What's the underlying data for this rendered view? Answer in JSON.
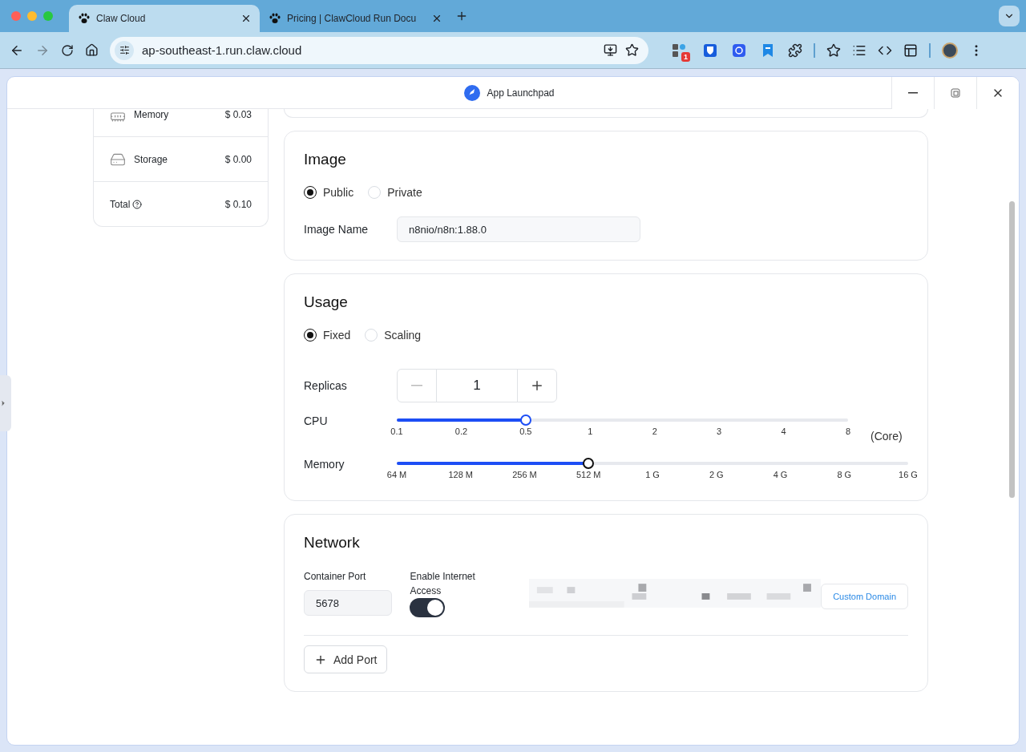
{
  "browser": {
    "tabs": [
      {
        "title": "Claw Cloud",
        "selected": true
      },
      {
        "title": "Pricing | ClawCloud Run Docu",
        "selected": false
      }
    ],
    "url": "ap-southeast-1.run.claw.cloud",
    "extension_badge": "1"
  },
  "window": {
    "title": "App Launchpad"
  },
  "cost": [
    {
      "kind": "memory",
      "label": "Memory",
      "value": "$ 0.03"
    },
    {
      "kind": "storage",
      "label": "Storage",
      "value": "$ 0.00"
    },
    {
      "kind": "total",
      "label": "Total",
      "value": "$ 0.10"
    }
  ],
  "image": {
    "title": "Image",
    "options": [
      {
        "label": "Public",
        "selected": true
      },
      {
        "label": "Private",
        "selected": false
      }
    ],
    "name_label": "Image Name",
    "name_value": "n8nio/n8n:1.88.0"
  },
  "usage": {
    "title": "Usage",
    "options": [
      {
        "label": "Fixed",
        "selected": true
      },
      {
        "label": "Scaling",
        "selected": false
      }
    ],
    "replicas_label": "Replicas",
    "replicas_value": "1",
    "cpu": {
      "label": "CPU",
      "level": 0.286,
      "ticks": [
        "0.1",
        "0.2",
        "0.5",
        "1",
        "2",
        "3",
        "4",
        "8"
      ],
      "unit": "(Core)"
    },
    "memory": {
      "label": "Memory",
      "level": 0.375,
      "ticks": [
        "64 M",
        "128 M",
        "256 M",
        "512 M",
        "1 G",
        "2 G",
        "4 G",
        "8 G",
        "16 G"
      ]
    }
  },
  "network": {
    "title": "Network",
    "port_label": "Container Port",
    "port_value": "5678",
    "internet_label": "Enable Internet Access",
    "internet_on": true,
    "custom_domain": "Custom Domain",
    "add_port": "Add Port"
  }
}
